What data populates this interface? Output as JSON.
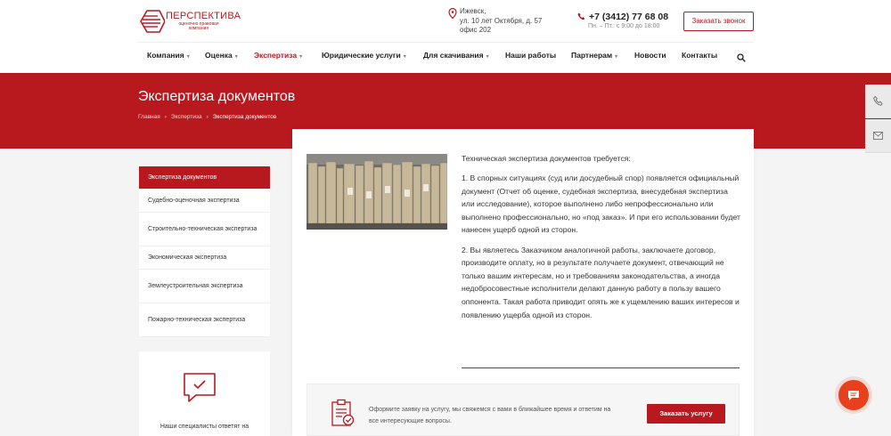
{
  "header": {
    "logo_name": "ПЕРСПЕКТИВА",
    "logo_sub": "оценочно правовая компания",
    "address_lines": [
      "Ижевск,",
      "ул. 10 лет Октября, д. 57",
      "офис 202"
    ],
    "phone": "+7 (3412) 77 68 08",
    "hours": "Пн. – Пт.: с 9:00 до 18:00",
    "call_button": "Заказать звонок"
  },
  "nav": {
    "items": [
      {
        "label": "Компания",
        "dropdown": true
      },
      {
        "label": "Оценка",
        "dropdown": true
      },
      {
        "label": "Экспертиза",
        "dropdown": true,
        "active": true
      },
      {
        "label": "Юридические услуги",
        "dropdown": true
      },
      {
        "label": "Для скачивания",
        "dropdown": true
      },
      {
        "label": "Наши работы",
        "dropdown": false
      },
      {
        "label": "Партнерам",
        "dropdown": true
      },
      {
        "label": "Новости",
        "dropdown": false
      },
      {
        "label": "Контакты",
        "dropdown": false
      }
    ],
    "search_icon": "search-icon"
  },
  "banner": {
    "title": "Экспертиза документов",
    "breadcrumb": [
      "Главная",
      "Экспертиза",
      "Экспертиза документов"
    ],
    "color": "#b8191f"
  },
  "sidebar": {
    "items": [
      {
        "label": "Экспертиза документов",
        "active": true
      },
      {
        "label": "Судебно-оценочная экспертиза"
      },
      {
        "label": "Строительно-техническая экспертиза"
      },
      {
        "label": "Экономическая экспертиза"
      },
      {
        "label": "Землеустроительная экспертиза"
      },
      {
        "label": "Пожарно-техническая экспертиза"
      }
    ],
    "box_text": "Наши специалисты ответят на"
  },
  "content": {
    "paragraphs": [
      "Техническая экспертиза документов требуется:",
      "1. В спорных ситуациях (суд или досудебный спор) появляется официальный документ (Отчет об оценке, судебная экспертиза, внесудебная экспертиза или исследование), которое выполнено либо непрофессионально или выполнено профессионально, но «под заказ». И при его использовании будет нанесен ущерб одной из сторон.",
      "2. Вы являетесь Заказчиком аналогичной работы, заключаете договор, производите оплату, но в результате получаете документ, отвечающий не только вашим интересам, но и требованиям законодательства, а иногда недобросовестные исполнители делают данную работу в пользу вашего оппонента. Такая работа приводит опять же к ущемлению ваших интересов и появлению ущерба одной из сторон."
    ]
  },
  "cta": {
    "text": "Оформите заявку на услугу, мы свяжемся с вами в ближайшее время и ответим на все интересующие вопросы.",
    "button": "Заказать услугу"
  }
}
